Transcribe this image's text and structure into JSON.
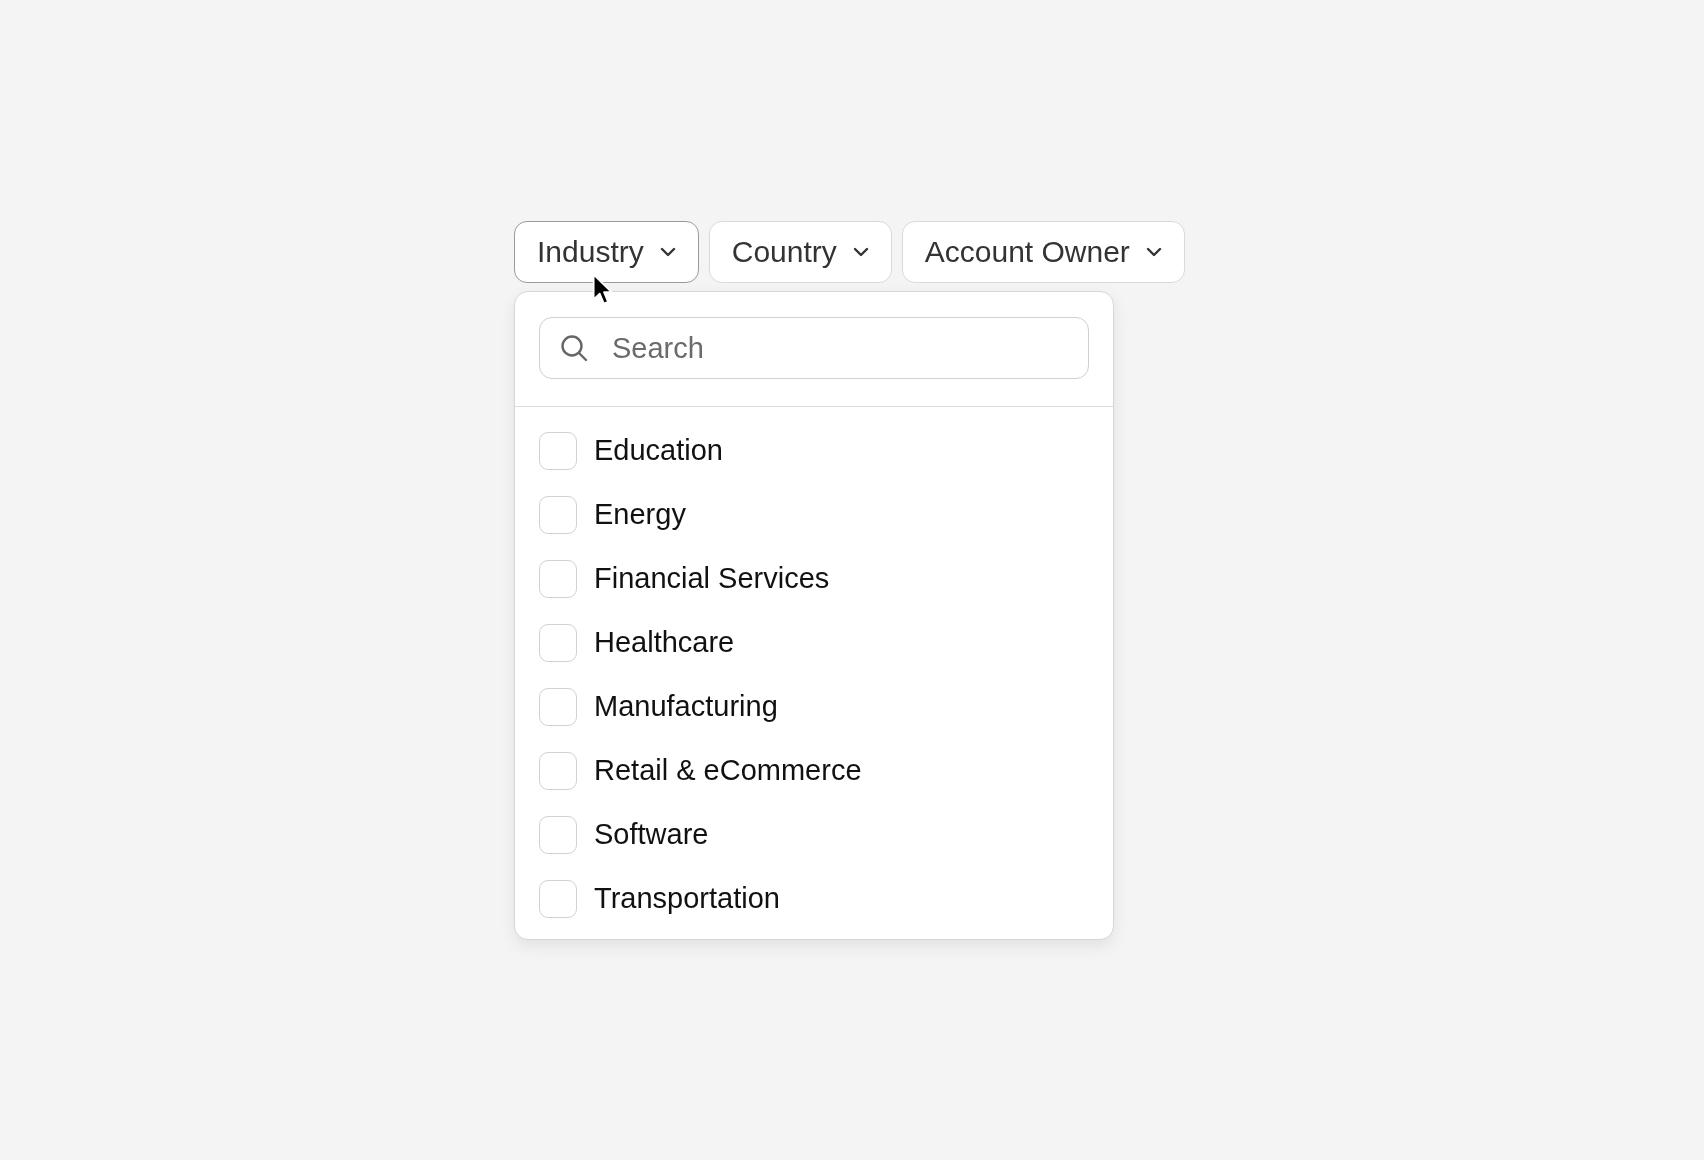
{
  "filters": [
    {
      "label": "Industry",
      "open": true
    },
    {
      "label": "Country",
      "open": false
    },
    {
      "label": "Account Owner",
      "open": false
    }
  ],
  "dropdown": {
    "search": {
      "placeholder": "Search"
    },
    "options": [
      {
        "label": "Education",
        "checked": false
      },
      {
        "label": "Energy",
        "checked": false
      },
      {
        "label": "Financial Services",
        "checked": false
      },
      {
        "label": "Healthcare",
        "checked": false
      },
      {
        "label": "Manufacturing",
        "checked": false
      },
      {
        "label": "Retail & eCommerce",
        "checked": false
      },
      {
        "label": "Software",
        "checked": false
      },
      {
        "label": "Transportation",
        "checked": false
      }
    ]
  }
}
